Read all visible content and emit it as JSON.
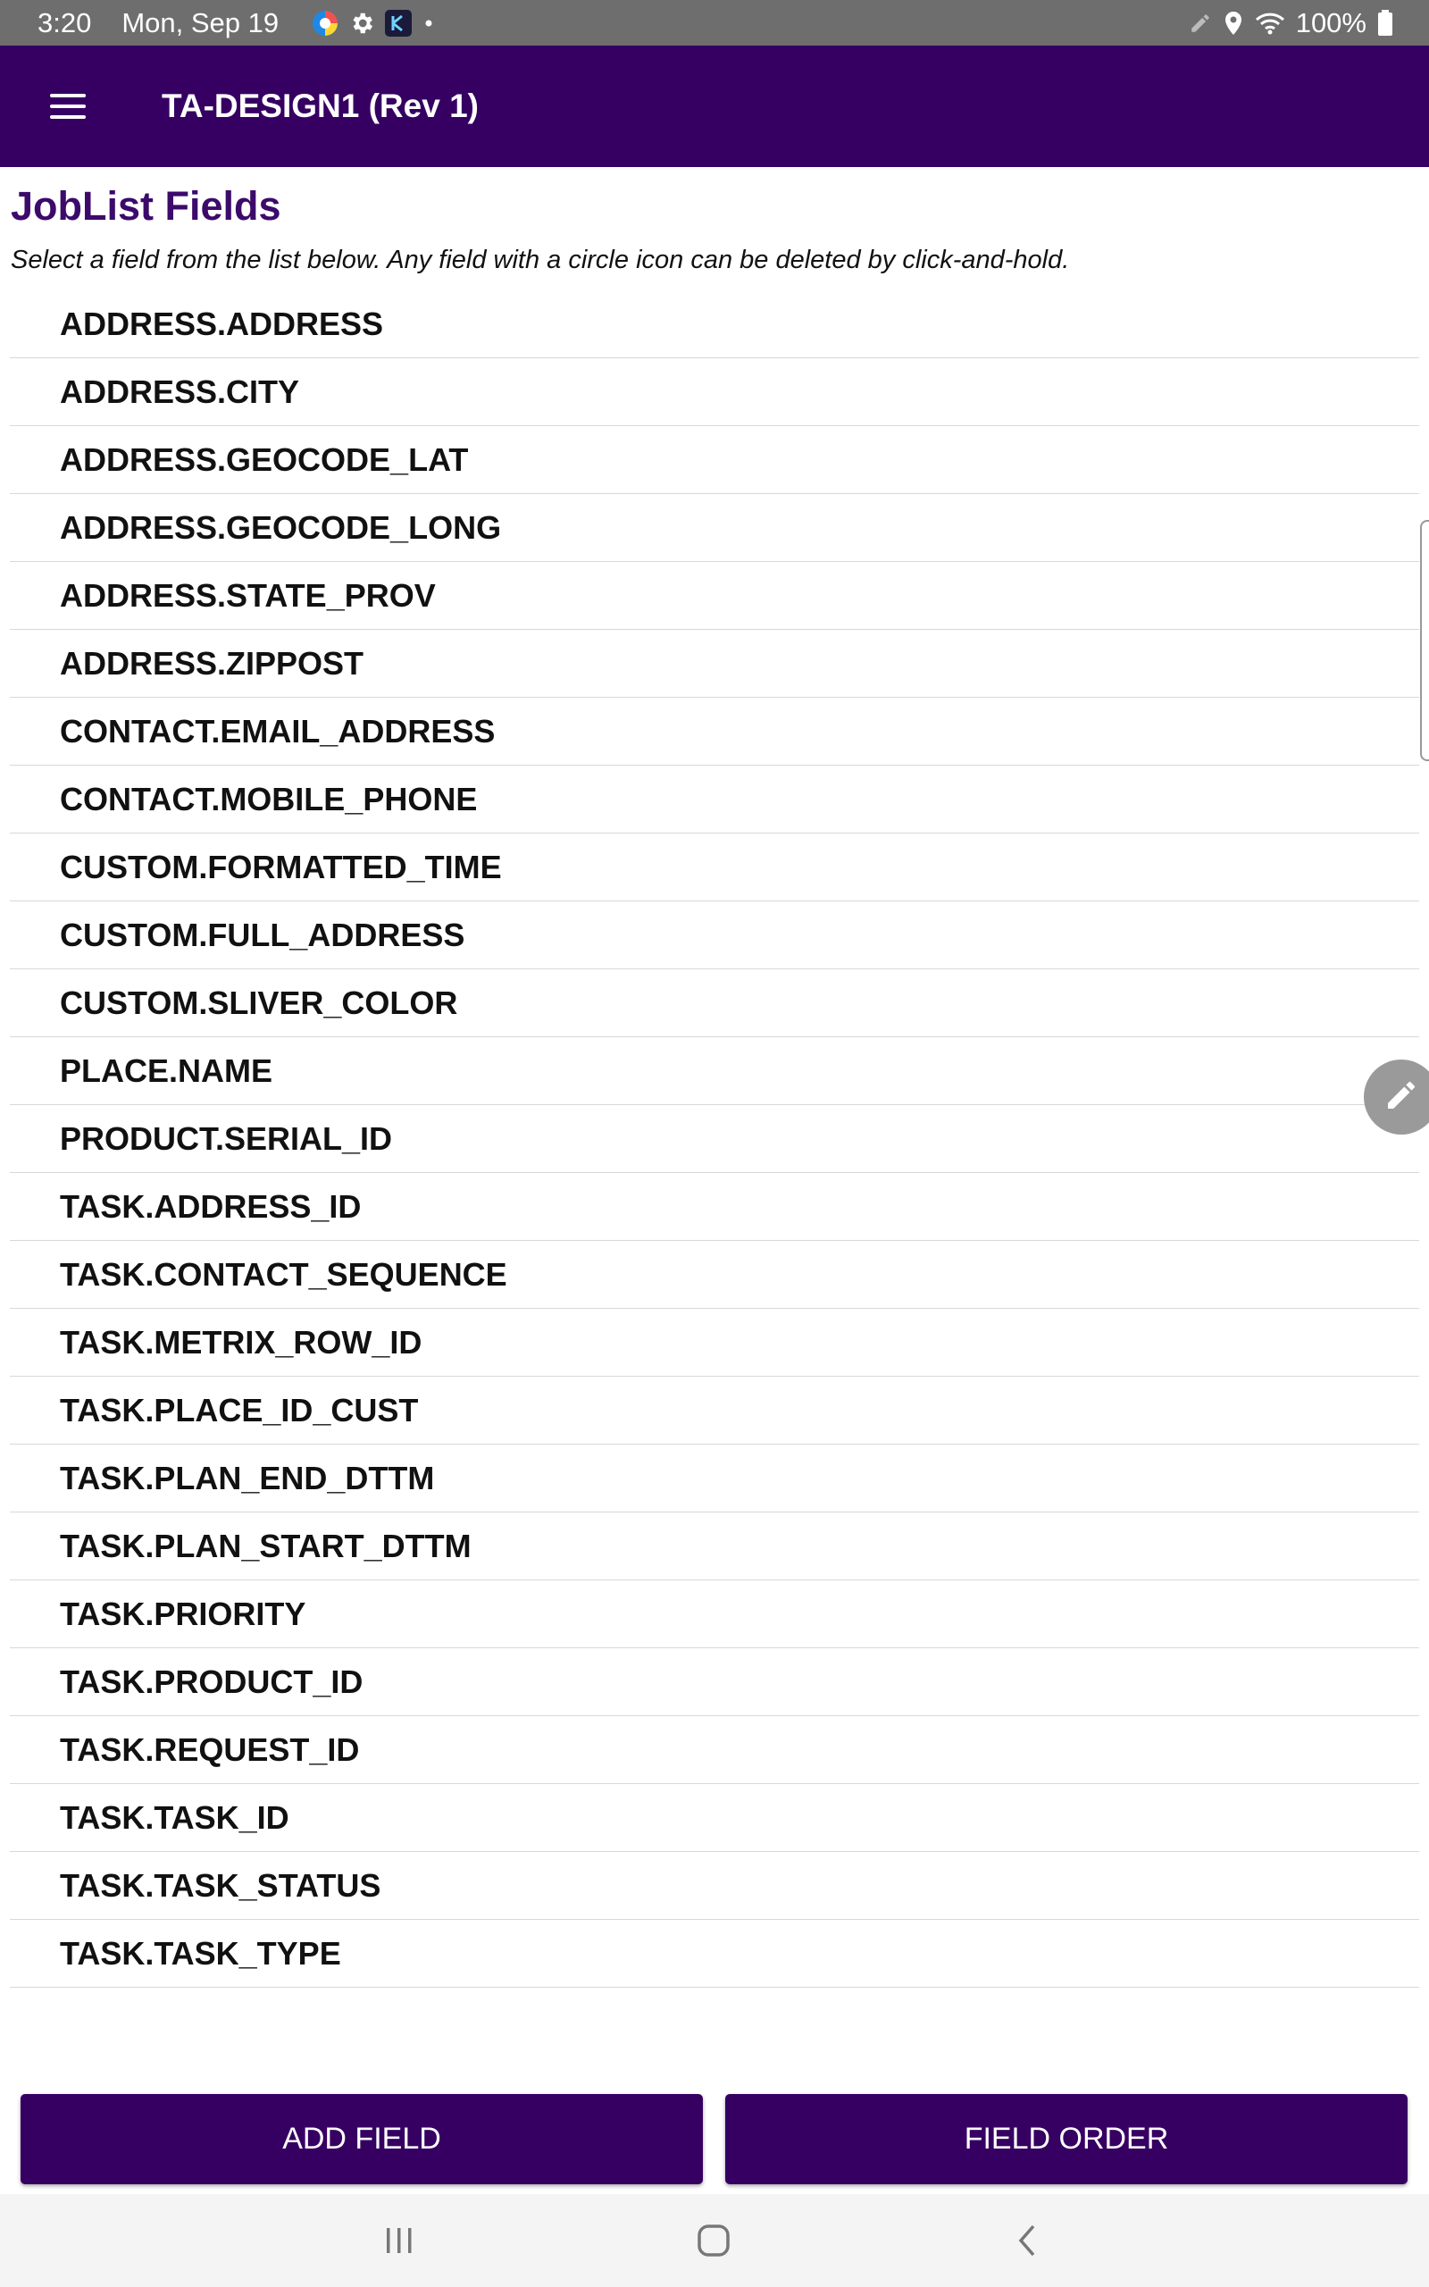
{
  "status_bar": {
    "time": "3:20",
    "date": "Mon, Sep 19",
    "battery": "100%",
    "icons_left": [
      "browser-icon",
      "settings-gear-icon",
      "app-k-icon",
      "dot-icon"
    ],
    "icons_right": [
      "edit-pencil-icon",
      "location-pin-icon",
      "wifi-icon",
      "battery-icon"
    ]
  },
  "app_bar": {
    "title": "TA-DESIGN1 (Rev 1)",
    "menu_icon": "hamburger-menu-icon"
  },
  "page": {
    "heading": "JobList Fields",
    "instructions": "Select a field from the list below. Any field with a circle icon can be deleted by click-and-hold."
  },
  "fields": [
    "ADDRESS.ADDRESS",
    "ADDRESS.CITY",
    "ADDRESS.GEOCODE_LAT",
    "ADDRESS.GEOCODE_LONG",
    "ADDRESS.STATE_PROV",
    "ADDRESS.ZIPPOST",
    "CONTACT.EMAIL_ADDRESS",
    "CONTACT.MOBILE_PHONE",
    "CUSTOM.FORMATTED_TIME",
    "CUSTOM.FULL_ADDRESS",
    "CUSTOM.SLIVER_COLOR",
    "PLACE.NAME",
    "PRODUCT.SERIAL_ID",
    "TASK.ADDRESS_ID",
    "TASK.CONTACT_SEQUENCE",
    "TASK.METRIX_ROW_ID",
    "TASK.PLACE_ID_CUST",
    "TASK.PLAN_END_DTTM",
    "TASK.PLAN_START_DTTM",
    "TASK.PRIORITY",
    "TASK.PRODUCT_ID",
    "TASK.REQUEST_ID",
    "TASK.TASK_ID",
    "TASK.TASK_STATUS",
    "TASK.TASK_TYPE"
  ],
  "buttons": {
    "add_field": "ADD FIELD",
    "field_order": "FIELD ORDER"
  },
  "colors": {
    "app_bar": "#360062",
    "heading": "#3c0a6b",
    "status_bar": "#6e6e6e"
  }
}
